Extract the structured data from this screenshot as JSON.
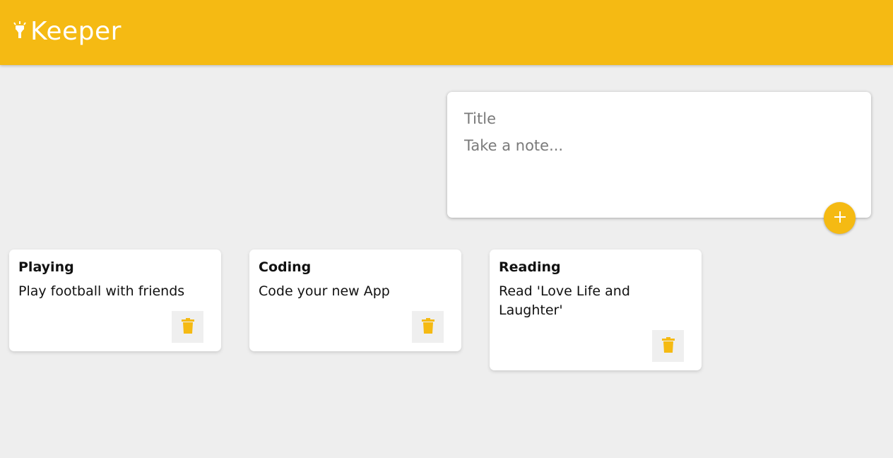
{
  "app": {
    "name": "Keeper"
  },
  "colors": {
    "accent": "#f5ba13",
    "background": "#eeeeee",
    "card": "#ffffff",
    "delete_button_bg": "#efefef"
  },
  "create_note": {
    "title_placeholder": "Title",
    "content_placeholder": "Take a note...",
    "title_value": "",
    "content_value": "",
    "add_icon": "plus-icon"
  },
  "notes": [
    {
      "title": "Playing",
      "content": "Play football with friends",
      "delete_icon": "trash-icon"
    },
    {
      "title": "Coding",
      "content": "Code your new App",
      "delete_icon": "trash-icon"
    },
    {
      "title": "Reading",
      "content": "Read 'Love Life and Laughter'",
      "delete_icon": "trash-icon"
    }
  ]
}
